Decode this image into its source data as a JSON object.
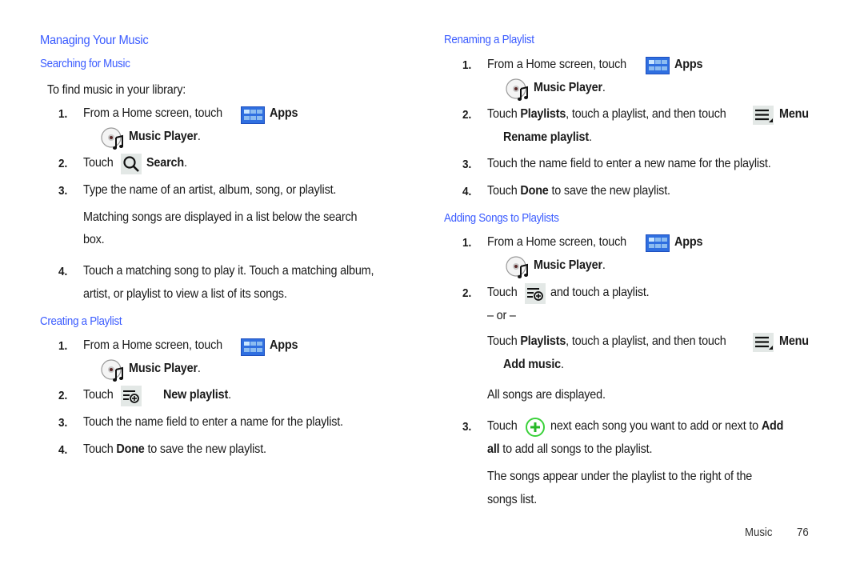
{
  "left": {
    "section_title": "Managing Your Music",
    "searching": {
      "heading": "Searching for Music",
      "intro": "To find music in your library:",
      "steps": [
        {
          "num": "1.",
          "pre": "From a Home screen, touch",
          "apps": "Apps",
          "music_player": "Music Player",
          "end": "."
        },
        {
          "num": "2.",
          "pre": "Touch",
          "bold": "Search",
          "end": "."
        },
        {
          "num": "3.",
          "text": "Type the name of an artist, album, song, or playlist.",
          "note_line1": "Matching songs are displayed in a list below the search",
          "note_line2": "box."
        },
        {
          "num": "4.",
          "line1": "Touch a matching song to play it. Touch a matching album,",
          "line2": "artist, or playlist to view a list of its songs."
        }
      ]
    },
    "creating": {
      "heading": "Creating a Playlist",
      "steps": [
        {
          "num": "1.",
          "pre": "From a Home screen, touch",
          "apps": "Apps",
          "music_player": "Music Player",
          "end": "."
        },
        {
          "num": "2.",
          "pre": "Touch",
          "bold": "New playlist",
          "end": "."
        },
        {
          "num": "3.",
          "text": "Touch the name field to enter a name for the playlist."
        },
        {
          "num": "4.",
          "pre": "Touch",
          "bold": "Done",
          "post": "to save the new playlist."
        }
      ]
    }
  },
  "right": {
    "renaming": {
      "heading": "Renaming a Playlist",
      "steps": [
        {
          "num": "1.",
          "pre": "From a Home screen, touch",
          "apps": "Apps",
          "music_player": "Music Player",
          "end": "."
        },
        {
          "num": "2.",
          "pre": "Touch",
          "bold1": "Playlists",
          "mid": ", touch a playlist, and then touch",
          "menu": "Menu",
          "bold2": "Rename playlist",
          "end": "."
        },
        {
          "num": "3.",
          "text": "Touch the name field to enter a new name for the playlist."
        },
        {
          "num": "4.",
          "pre": "Touch",
          "bold": "Done",
          "post": "to save the new playlist."
        }
      ]
    },
    "adding": {
      "heading": "Adding Songs to Playlists",
      "steps": [
        {
          "num": "1.",
          "pre": "From a Home screen, touch",
          "apps": "Apps",
          "music_player": "Music Player",
          "end": "."
        },
        {
          "num": "2.",
          "pre": "Touch",
          "post": "and touch a playlist.",
          "or": "– or –",
          "alt_pre": "Touch",
          "alt_bold1": "Playlists",
          "alt_mid": ", touch a playlist, and then touch",
          "alt_menu": "Menu",
          "alt_bold2": "Add music",
          "alt_end": ".",
          "result": "All songs are displayed."
        },
        {
          "num": "3.",
          "pre": "Touch",
          "mid": "next each song you want to add or next to",
          "bold1": "Add",
          "bold2": "all",
          "post": "to add all songs to the playlist.",
          "note_line1": "The songs appear under the playlist to the right of the",
          "note_line2": "songs list."
        }
      ]
    }
  },
  "footer": {
    "section": "Music",
    "page": "76"
  },
  "colors": {
    "heading": "#3a5bff",
    "apps_icon": "#2f6fe0",
    "add_icon": "#3ad13a"
  }
}
